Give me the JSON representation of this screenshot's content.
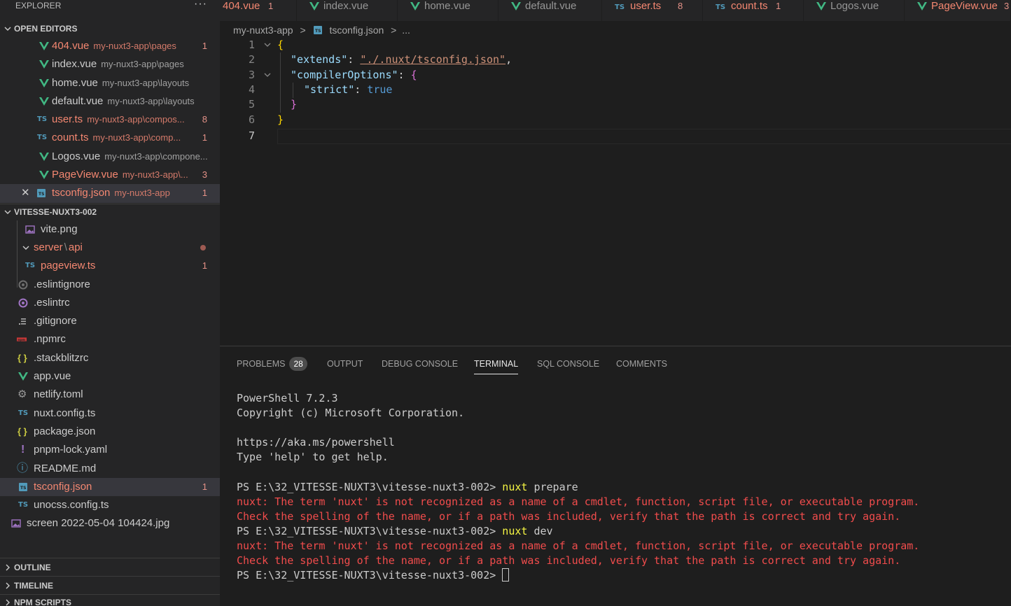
{
  "sidebar": {
    "title": "EXPLORER",
    "more": "···",
    "open_editors": {
      "header": "OPEN EDITORS",
      "items": [
        {
          "name": "404.vue",
          "path": "my-nuxt3-app\\pages",
          "badge": "1"
        },
        {
          "name": "index.vue",
          "path": "my-nuxt3-app\\pages",
          "badge": ""
        },
        {
          "name": "home.vue",
          "path": "my-nuxt3-app\\layouts",
          "badge": ""
        },
        {
          "name": "default.vue",
          "path": "my-nuxt3-app\\layouts",
          "badge": ""
        },
        {
          "name": "user.ts",
          "path": "my-nuxt3-app\\compos...",
          "badge": "8"
        },
        {
          "name": "count.ts",
          "path": "my-nuxt3-app\\comp...",
          "badge": "1"
        },
        {
          "name": "Logos.vue",
          "path": "my-nuxt3-app\\compone...",
          "badge": ""
        },
        {
          "name": "PageView.vue",
          "path": "my-nuxt3-app\\...",
          "badge": "3"
        },
        {
          "name": "tsconfig.json",
          "path": "my-nuxt3-app",
          "badge": "1"
        }
      ]
    },
    "project": {
      "header": "VITESSE-NUXT3-002",
      "items": [
        {
          "name": "vite.png"
        },
        {
          "name": "server",
          "sep": "\\",
          "name2": "api"
        },
        {
          "name": "pageview.ts",
          "badge": "1"
        },
        {
          "name": ".eslintignore"
        },
        {
          "name": ".eslintrc"
        },
        {
          "name": ".gitignore"
        },
        {
          "name": ".npmrc"
        },
        {
          "name": ".stackblitzrc"
        },
        {
          "name": "app.vue"
        },
        {
          "name": "netlify.toml"
        },
        {
          "name": "nuxt.config.ts"
        },
        {
          "name": "package.json"
        },
        {
          "name": "pnpm-lock.yaml"
        },
        {
          "name": "README.md"
        },
        {
          "name": "tsconfig.json",
          "badge": "1"
        },
        {
          "name": "unocss.config.ts"
        },
        {
          "name": "screen 2022-05-04 104424.jpg"
        }
      ]
    },
    "outline": "OUTLINE",
    "timeline": "TIMELINE",
    "npm": "NPM SCRIPTS"
  },
  "tabs": [
    {
      "label": "404.vue",
      "badge": "1"
    },
    {
      "label": "index.vue",
      "badge": ""
    },
    {
      "label": "home.vue",
      "badge": ""
    },
    {
      "label": "default.vue",
      "badge": ""
    },
    {
      "label": "user.ts",
      "badge": "8"
    },
    {
      "label": "count.ts",
      "badge": "1"
    },
    {
      "label": "Logos.vue",
      "badge": ""
    },
    {
      "label": "PageView.vue",
      "badge": "3"
    }
  ],
  "breadcrumb": {
    "root": "my-nuxt3-app",
    "sep": ">",
    "file": "tsconfig.json",
    "sep2": ">",
    "tail": "..."
  },
  "editor": {
    "lines": [
      "1",
      "2",
      "3",
      "4",
      "5",
      "6",
      "7"
    ],
    "tokens": {
      "open": "{",
      "extends_key": "\"extends\"",
      "colon": ": ",
      "extends_val": "\"./.nuxt/tsconfig.json\"",
      "comma": ",",
      "co_key": "\"compilerOptions\"",
      "co_open": "{",
      "strict_key": "\"strict\"",
      "strict_val": "true",
      "co_close": "}",
      "close": "}"
    }
  },
  "panel": {
    "tabs": {
      "problems": "PROBLEMS",
      "problems_count": "28",
      "output": "OUTPUT",
      "debug": "DEBUG CONSOLE",
      "terminal": "TERMINAL",
      "sql": "SQL CONSOLE",
      "comments": "COMMENTS"
    },
    "terminal": {
      "l1": "PowerShell 7.2.3",
      "l2": "Copyright (c) Microsoft Corporation.",
      "l3": "https://aka.ms/powershell",
      "l4": "Type 'help' to get help.",
      "prompt": "PS E:\\32_VITESSE-NUXT3\\vitesse-nuxt3-002> ",
      "cmd1": "nuxt",
      "arg1": " prepare",
      "err1": "nuxt: The term 'nuxt' is not recognized as a name of a cmdlet, function, script file, or executable program.",
      "err2": "Check the spelling of the name, or if a path was included, verify that the path is correct and try again.",
      "cmd2": "nuxt",
      "arg2": " dev"
    }
  },
  "icons": {
    "vue": "vue-icon",
    "ts": "TS",
    "json": "{ }",
    "yaml": "!",
    "info": "ⓘ"
  },
  "colors": {
    "vue": "#41b883",
    "ts": "#519aba",
    "json": "#cbcb41",
    "error": "#f48771",
    "terminal_error": "#f14c4c",
    "accent_key": "#9cdcfe"
  }
}
